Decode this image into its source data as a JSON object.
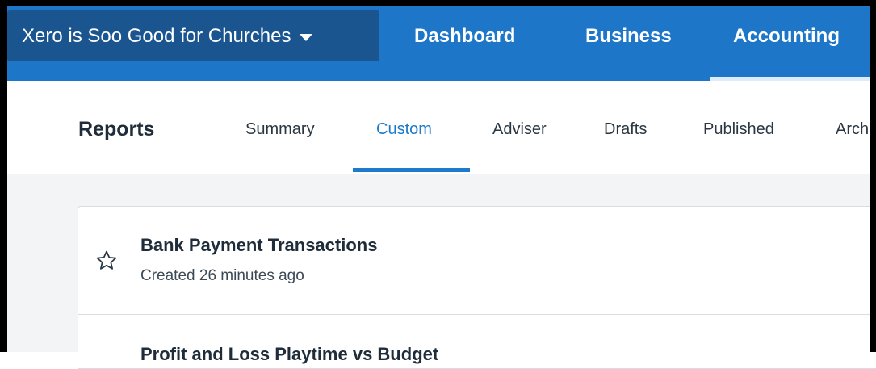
{
  "header": {
    "org_name": "Xero is Soo Good for Churches",
    "nav": [
      {
        "label": "Dashboard"
      },
      {
        "label": "Business"
      },
      {
        "label": "Accounting"
      }
    ]
  },
  "subnav": {
    "title": "Reports",
    "tabs": [
      {
        "label": "Summary"
      },
      {
        "label": "Custom"
      },
      {
        "label": "Adviser"
      },
      {
        "label": "Drafts"
      },
      {
        "label": "Published"
      },
      {
        "label": "Arch"
      }
    ],
    "active_tab": "Custom"
  },
  "reports": [
    {
      "title": "Bank Payment Transactions",
      "subtitle": "Created 26 minutes ago"
    },
    {
      "title": "Profit and Loss Playtime vs Budget"
    }
  ],
  "icons": {
    "favourite": "star-outline-icon",
    "org_menu": "caret-down-icon"
  },
  "colors": {
    "brand_blue": "#1e76c8",
    "org_switcher_bg": "#1b5590",
    "active_tab": "#1b7ac9"
  }
}
